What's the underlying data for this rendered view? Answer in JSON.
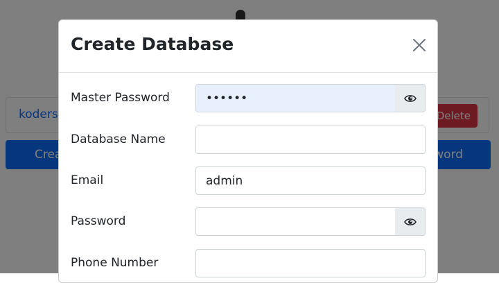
{
  "background": {
    "db_name": "kodersh",
    "delete_label": "Delete",
    "create_label": "Crea",
    "right_button_label": "word"
  },
  "modal": {
    "title": "Create Database",
    "fields": [
      {
        "label": "Master Password",
        "value": "••••••",
        "type": "password",
        "toggle_icon": "eye-icon"
      },
      {
        "label": "Database Name",
        "value": "",
        "type": "text"
      },
      {
        "label": "Email",
        "value": "admin",
        "type": "text"
      },
      {
        "label": "Password",
        "value": "",
        "type": "password",
        "toggle_icon": "eye-icon"
      },
      {
        "label": "Phone Number",
        "value": "",
        "type": "text"
      }
    ]
  },
  "colors": {
    "primary": "#0d6efd",
    "danger": "#dc3545",
    "autofill": "#e8f0fe",
    "addon": "#e9ecef"
  }
}
